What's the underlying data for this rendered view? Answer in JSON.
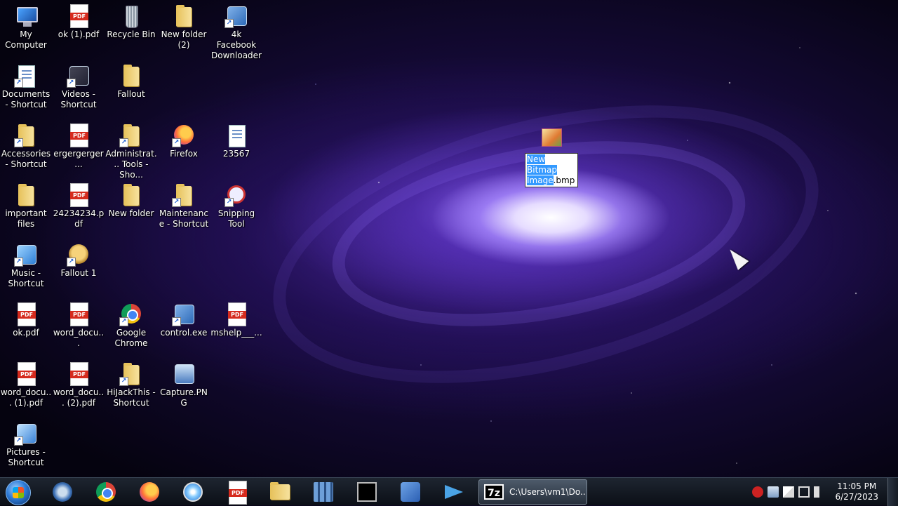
{
  "desktop": {
    "icons": [
      {
        "label": "My Computer",
        "icon": "my-computer-icon"
      },
      {
        "label": "ok (1).pdf",
        "icon": "pdf-file-icon"
      },
      {
        "label": "Recycle Bin",
        "icon": "recycle-bin-icon"
      },
      {
        "label": "New folder (2)",
        "icon": "folder-icon"
      },
      {
        "label": "4k Facebook Downloader",
        "icon": "facebook-downloader-icon"
      },
      {
        "label": "Documents - Shortcut",
        "icon": "documents-shortcut-icon"
      },
      {
        "label": "Videos - Shortcut",
        "icon": "videos-shortcut-icon"
      },
      {
        "label": "Fallout",
        "icon": "folder-icon"
      },
      {
        "label": "Accessories - Shortcut",
        "icon": "folder-shortcut-icon"
      },
      {
        "label": "ergergerger...",
        "icon": "pdf-file-icon"
      },
      {
        "label": "Administrat... Tools - Sho...",
        "icon": "folder-shortcut-icon"
      },
      {
        "label": "Firefox",
        "icon": "firefox-icon"
      },
      {
        "label": "23567",
        "icon": "document-icon"
      },
      {
        "label": "important files",
        "icon": "folder-icon"
      },
      {
        "label": "24234234.pdf",
        "icon": "pdf-file-icon"
      },
      {
        "label": "New folder",
        "icon": "folder-icon"
      },
      {
        "label": "Maintenance - Shortcut",
        "icon": "folder-shortcut-icon"
      },
      {
        "label": "Snipping Tool",
        "icon": "snipping-tool-icon"
      },
      {
        "label": "Music - Shortcut",
        "icon": "music-shortcut-icon"
      },
      {
        "label": "Fallout 1",
        "icon": "fallout-icon"
      },
      {
        "label": "ok.pdf",
        "icon": "pdf-file-icon"
      },
      {
        "label": "word_docu...",
        "icon": "pdf-file-icon"
      },
      {
        "label": "Google Chrome",
        "icon": "chrome-icon"
      },
      {
        "label": "control.exe",
        "icon": "control-panel-icon"
      },
      {
        "label": "mshelp___...",
        "icon": "pdf-file-icon"
      },
      {
        "label": "word_docu... (1).pdf",
        "icon": "pdf-file-icon"
      },
      {
        "label": "word_docu... (2).pdf",
        "icon": "pdf-file-icon"
      },
      {
        "label": "HiJackThis - Shortcut",
        "icon": "folder-shortcut-icon"
      },
      {
        "label": "Capture.PNG",
        "icon": "image-file-icon"
      },
      {
        "label": "Pictures - Shortcut",
        "icon": "pictures-shortcut-icon"
      }
    ],
    "renaming_icon": {
      "icon": "bitmap-image-icon",
      "selected_text": "New Bitmap Image",
      "extension": ".bmp"
    }
  },
  "taskbar": {
    "start": "start-button",
    "pinned": [
      {
        "name": "network-settings-icon"
      },
      {
        "name": "chrome-icon"
      },
      {
        "name": "firefox-icon"
      },
      {
        "name": "safari-compass-icon"
      },
      {
        "name": "pdf-tool-icon"
      },
      {
        "name": "file-explorer-icon"
      },
      {
        "name": "server-manager-icon"
      },
      {
        "name": "command-prompt-icon"
      },
      {
        "name": "facebook-downloader-icon"
      },
      {
        "name": "telegram-icon"
      }
    ],
    "active_window": {
      "app": "7z",
      "title": "C:\\Users\\vm1\\Do..."
    },
    "tray": [
      "security-alert-icon",
      "network-icon",
      "action-center-flag-icon",
      "display-icon",
      "volume-muted-icon"
    ],
    "clock": {
      "time": "11:05 PM",
      "date": "6/27/2023"
    }
  }
}
